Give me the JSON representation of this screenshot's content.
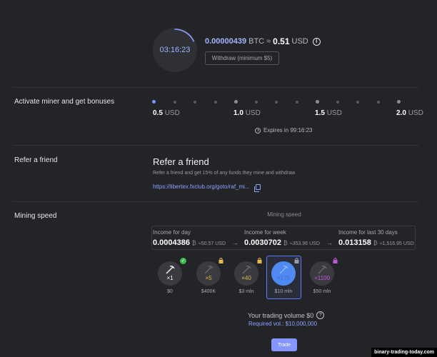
{
  "balance": {
    "timer": "03:16:23",
    "progress": 0.18,
    "btc_value": "0.00000439",
    "btc_unit": "BTC",
    "approx": "≈",
    "usd_value": "0.51",
    "usd_unit": "USD",
    "info_glyph": "i",
    "withdraw_label": "Withdraw (minimum $5)"
  },
  "activate": {
    "label": "Activate miner and get bonuses",
    "levels": [
      {
        "value": "0.5",
        "unit": "USD"
      },
      {
        "value": "1.0",
        "unit": "USD"
      },
      {
        "value": "1.5",
        "unit": "USD"
      },
      {
        "value": "2.0",
        "unit": "USD"
      }
    ],
    "current_level_index": 0,
    "expires": "Expires in 99:16:23"
  },
  "refer": {
    "label": "Refer a friend",
    "title": "Refer a friend",
    "description": "Refer a friend and get 15% of any funds they mine and withdraw",
    "link": "https://libertex.fxclub.org/goto/raf_mi..."
  },
  "mining": {
    "label": "Mining speed",
    "center_label": "Mining speed",
    "income": [
      {
        "label": "Income for day",
        "btc": "0.0004386",
        "btc_symbol": "₿",
        "usd": "≈50.57 USD"
      },
      {
        "label": "Income for week",
        "btc": "0.0030702",
        "btc_symbol": "₿",
        "usd": "≈353.96 USD"
      },
      {
        "label": "Income for last 30 days",
        "btc": "0.013158",
        "btc_symbol": "₿",
        "usd": "≈1,516.95 USD"
      }
    ],
    "arrow_glyph": "→",
    "tiers": [
      {
        "mult": "×1",
        "price": "$0",
        "color": "#ffffff",
        "status": "unlocked"
      },
      {
        "mult": "×5",
        "price": "$400K",
        "color": "#e7b84a",
        "status": "locked"
      },
      {
        "mult": "×40",
        "price": "$3 mln",
        "color": "#e7b84a",
        "status": "locked"
      },
      {
        "mult": "×170",
        "price": "$10 mln",
        "color": "#3f6bd6",
        "status": "selected-locked"
      },
      {
        "mult": "×1100",
        "price": "$50 mln",
        "color": "#c25ad8",
        "status": "locked"
      }
    ],
    "check_glyph": "✓",
    "volume_text": "Your trading volume $0",
    "q_glyph": "?",
    "required": "Required vol.: $10,000,000",
    "trade_label": "Trade"
  },
  "watermark": "binary-trading-today.com"
}
